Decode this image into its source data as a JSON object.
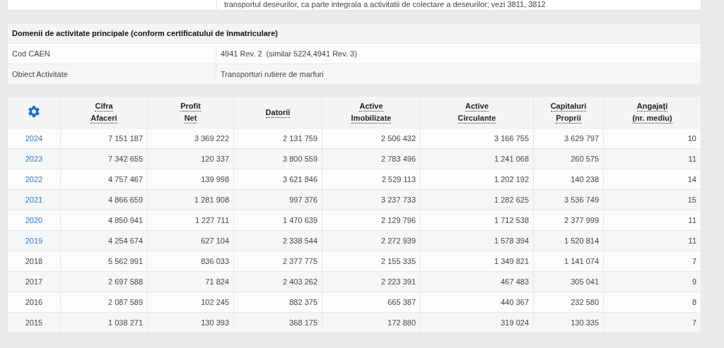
{
  "top_card": {
    "text": "transportul deseurilor, ca parte integrala a activitatii de colectare a deseurilor; vezi 3811, 3812"
  },
  "activity": {
    "title": "Domenii de activitate principale (conform certificatului de înmatriculare)",
    "rows": [
      {
        "label": "Cod CAEN",
        "value": "4941 Rev. 2  (similar 5224,4941 Rev. 3)"
      },
      {
        "label": "Obiect Activitate",
        "value": "Transporturi rutiere de marfuri"
      }
    ]
  },
  "financials": {
    "columns": [
      [
        "Cifra",
        "Afaceri"
      ],
      [
        "Profit",
        "Net"
      ],
      [
        "Datorii"
      ],
      [
        "Active",
        "Imobilizate"
      ],
      [
        "Active",
        "Circulante"
      ],
      [
        "Capitaluri",
        "Proprii"
      ],
      [
        "Angajați",
        "(nr. mediu)"
      ]
    ],
    "rows": [
      {
        "year": "2024",
        "linked": true,
        "values": [
          "7 151 187",
          "3 369 222",
          "2 131 759",
          "2 506 432",
          "3 166 755",
          "3 629 797",
          "10"
        ]
      },
      {
        "year": "2023",
        "linked": true,
        "values": [
          "7 342 655",
          "120 337",
          "3 800 559",
          "2 783 496",
          "1 241 068",
          "260 575",
          "11"
        ]
      },
      {
        "year": "2022",
        "linked": true,
        "values": [
          "4 757 467",
          "139 998",
          "3 621 846",
          "2 529 113",
          "1 202 192",
          "140 238",
          "14"
        ]
      },
      {
        "year": "2021",
        "linked": true,
        "values": [
          "4 866 659",
          "1 281 908",
          "997 376",
          "3 237 733",
          "1 282 625",
          "3 536 749",
          "15"
        ]
      },
      {
        "year": "2020",
        "linked": true,
        "values": [
          "4 850 941",
          "1 227 711",
          "1 470 639",
          "2 129 796",
          "1 712 538",
          "2 377 999",
          "11"
        ]
      },
      {
        "year": "2019",
        "linked": true,
        "values": [
          "4 254 674",
          "627 104",
          "2 338 544",
          "2 272 939",
          "1 578 394",
          "1 520 814",
          "11"
        ]
      },
      {
        "year": "2018",
        "linked": false,
        "values": [
          "5 562 991",
          "836 033",
          "2 377 775",
          "2 155 335",
          "1 349 821",
          "1 141 074",
          "7"
        ]
      },
      {
        "year": "2017",
        "linked": false,
        "values": [
          "2 697 588",
          "71 824",
          "2 403 262",
          "2 223 391",
          "467 483",
          "305 041",
          "9"
        ]
      },
      {
        "year": "2016",
        "linked": false,
        "values": [
          "2 087 589",
          "102 245",
          "882 375",
          "665 387",
          "440 367",
          "232 580",
          "8"
        ]
      },
      {
        "year": "2015",
        "linked": false,
        "values": [
          "1 038 271",
          "130 393",
          "368 175",
          "172 880",
          "319 024",
          "130 335",
          "7"
        ]
      }
    ]
  }
}
